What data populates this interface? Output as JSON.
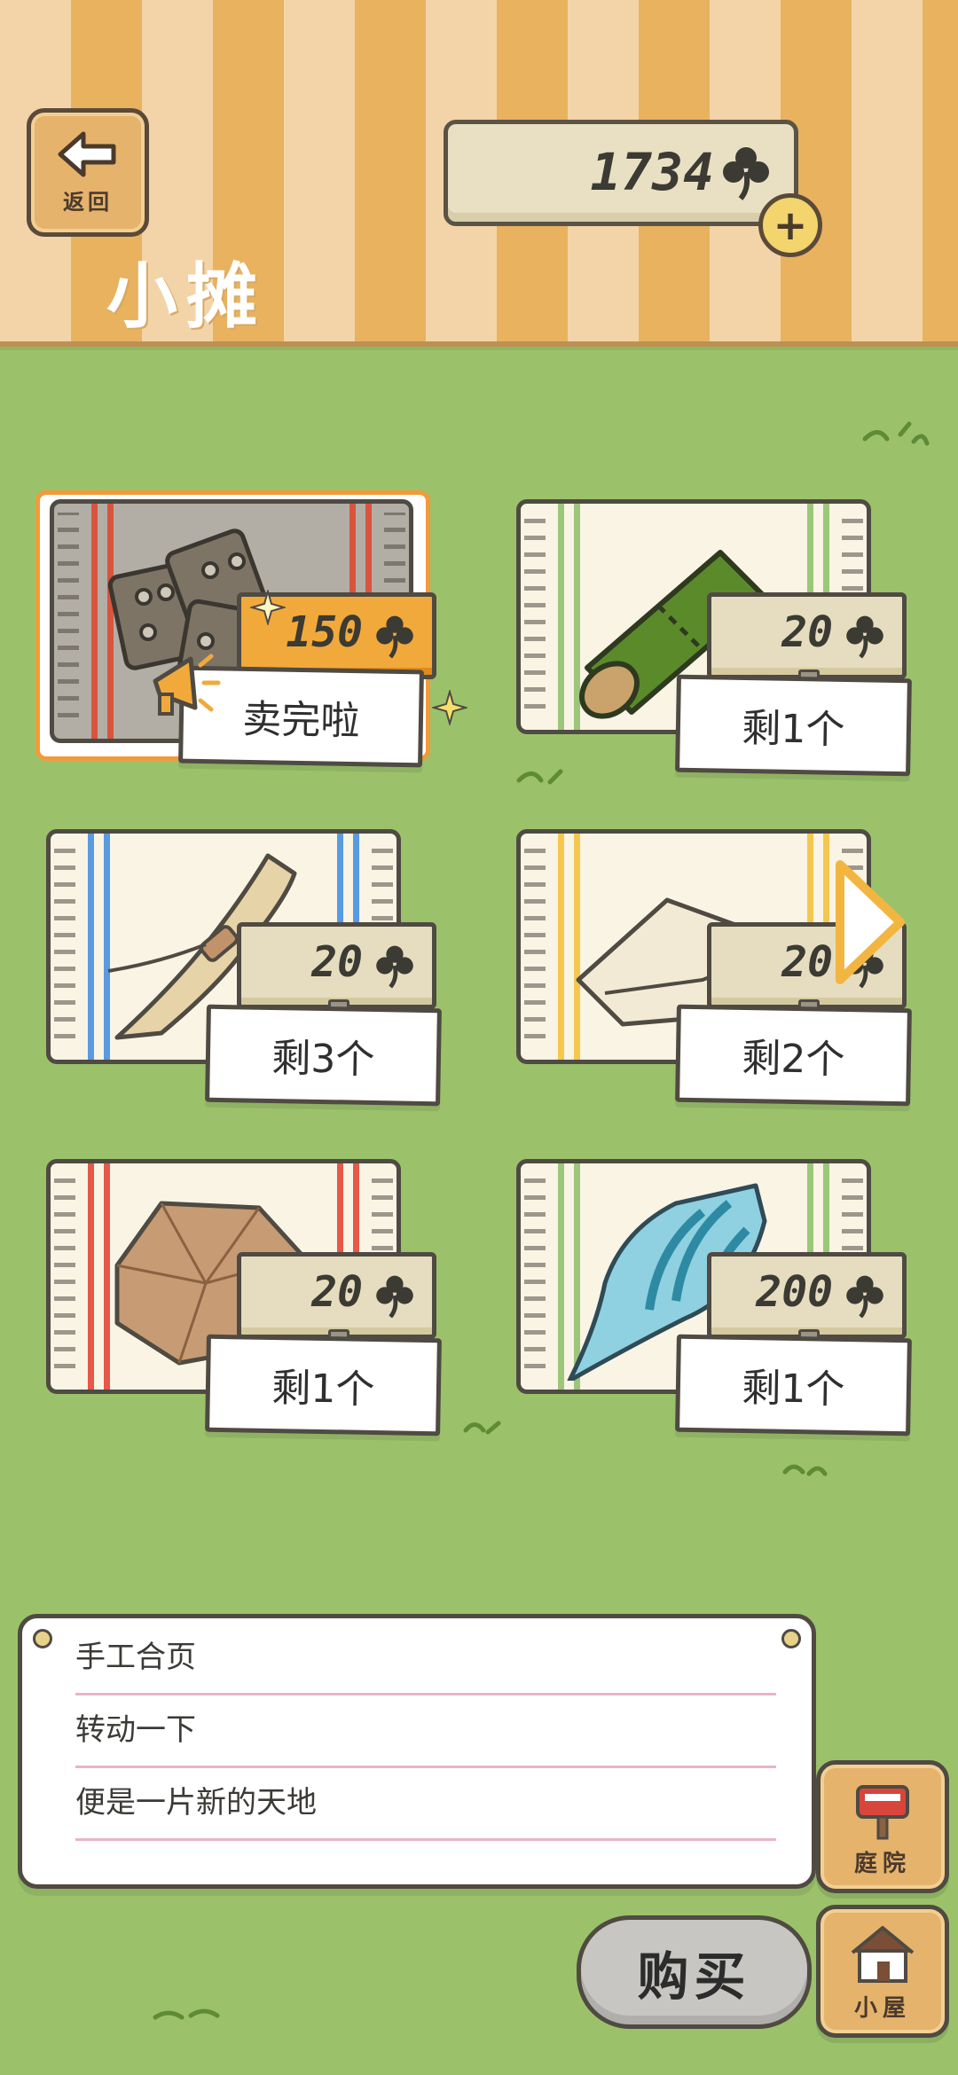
{
  "header": {
    "back_label": "返回",
    "title": "小摊",
    "currency_amount": "1734",
    "currency_icon": "clover-icon"
  },
  "items": [
    {
      "name": "handmade-hinge",
      "price": "150",
      "stock": "卖完啦",
      "sold_out": true,
      "stripe_color": "#d9543e"
    },
    {
      "name": "bamboo",
      "price": "20",
      "stock": "剩1个",
      "sold_out": false,
      "stripe_color": "#9cc77a"
    },
    {
      "name": "straw-bundle",
      "price": "20",
      "stock": "剩3个",
      "sold_out": false,
      "stripe_color": "#5a9ae0"
    },
    {
      "name": "cloth",
      "price": "20",
      "stock": "剩2个",
      "sold_out": false,
      "stripe_color": "#f4c84f"
    },
    {
      "name": "paper-lantern",
      "price": "20",
      "stock": "剩1个",
      "sold_out": false,
      "stripe_color": "#e5584a"
    },
    {
      "name": "conch-shell",
      "price": "200",
      "stock": "剩1个",
      "sold_out": false,
      "stripe_color": "#9cc77a"
    }
  ],
  "description": {
    "line1": "手工合页",
    "line2": "转动一下",
    "line3": "便是一片新的天地"
  },
  "side_buttons": {
    "yard_label": "庭院",
    "house_label": "小屋"
  },
  "buy_label": "购买",
  "colors": {
    "selected_border": "#f39a3a",
    "sold_out_price_tag": "#f2a93b",
    "grass": "#9bc26a"
  }
}
